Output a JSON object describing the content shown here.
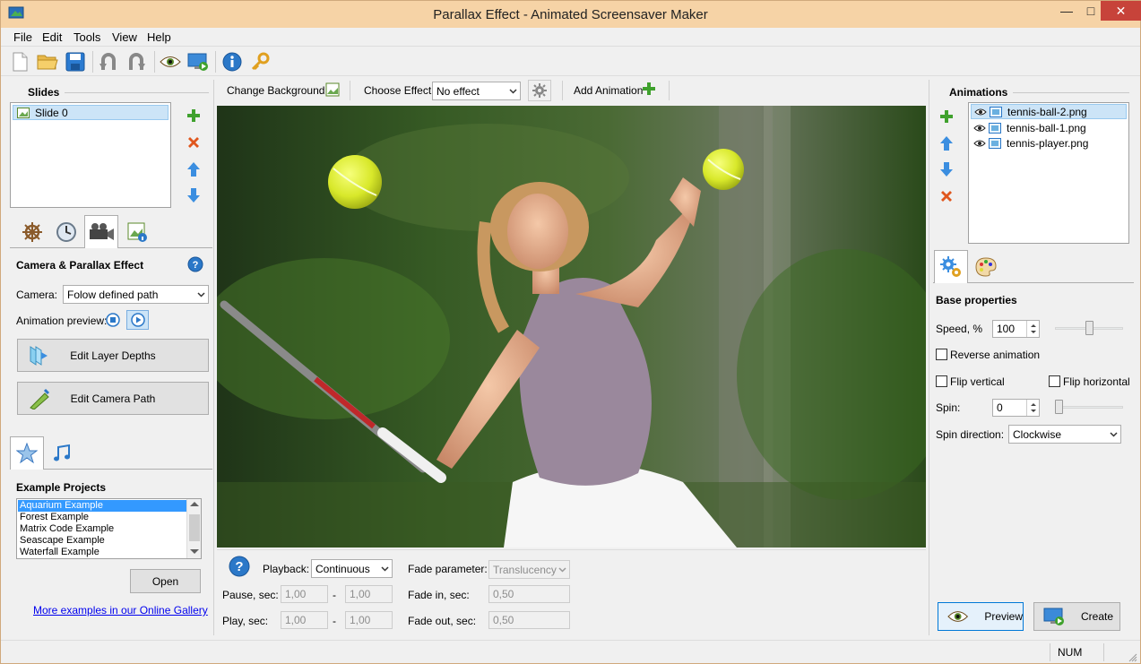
{
  "window": {
    "title": "Parallax Effect - Animated Screensaver Maker",
    "minimize_glyph": "—",
    "maximize_glyph": "□",
    "close_glyph": "✕"
  },
  "menu": [
    "File",
    "Edit",
    "Tools",
    "View",
    "Help"
  ],
  "colors": {
    "title_bar": "#f6d3a6",
    "close_button": "#c7433a",
    "selection": "#cce4f7",
    "add_green": "#3fa12d",
    "delete_orange": "#e0561d",
    "arrow_blue": "#3b8ee0",
    "link_blue": "#0000ee"
  },
  "slides": {
    "header": "Slides",
    "items": [
      {
        "label": "Slide 0",
        "selected": true
      }
    ]
  },
  "camera_panel": {
    "title": "Camera & Parallax Effect",
    "camera_label": "Camera:",
    "camera_value": "Folow defined path",
    "preview_label": "Animation preview:",
    "edit_depths": "Edit Layer Depths",
    "edit_path": "Edit Camera Path"
  },
  "examples": {
    "header": "Example Projects",
    "items": [
      "Aquarium Example",
      "Forest Example",
      "Matrix Code Example",
      "Seascape Example",
      "Waterfall Example"
    ],
    "selected": 0,
    "open_label": "Open",
    "gallery_link": "More examples in our Online Gallery"
  },
  "editor_toolbar": {
    "change_background": "Change Background",
    "choose_effect_label": "Choose Effect:",
    "effect_value": "No effect",
    "add_animation": "Add Animation"
  },
  "playback": {
    "playback_label": "Playback:",
    "playback_value": "Continuous",
    "pause_label": "Pause, sec:",
    "pause_from": "1,00",
    "pause_to": "1,00",
    "play_label": "Play, sec:",
    "play_from": "1,00",
    "play_to": "1,00",
    "dash": "-",
    "fade_param_label": "Fade parameter:",
    "fade_param_value": "Translucency",
    "fade_in_label": "Fade in, sec:",
    "fade_in_value": "0,50",
    "fade_out_label": "Fade out, sec:",
    "fade_out_value": "0,50"
  },
  "animations": {
    "header": "Animations",
    "items": [
      {
        "label": "tennis-ball-2.png",
        "selected": true
      },
      {
        "label": "tennis-ball-1.png",
        "selected": false
      },
      {
        "label": "tennis-player.png",
        "selected": false
      }
    ]
  },
  "base_properties": {
    "title": "Base properties",
    "speed_label": "Speed, %",
    "speed_value": "100",
    "speed_level": 0.5,
    "reverse_label": "Reverse animation",
    "flip_vertical_label": "Flip vertical",
    "flip_horizontal_label": "Flip horizontal",
    "spin_label": "Spin:",
    "spin_value": "0",
    "spin_level": 0.0,
    "spin_direction_label": "Spin direction:",
    "spin_direction_value": "Clockwise"
  },
  "actions": {
    "preview": "Preview",
    "create": "Create"
  },
  "status": {
    "num": "NUM"
  }
}
